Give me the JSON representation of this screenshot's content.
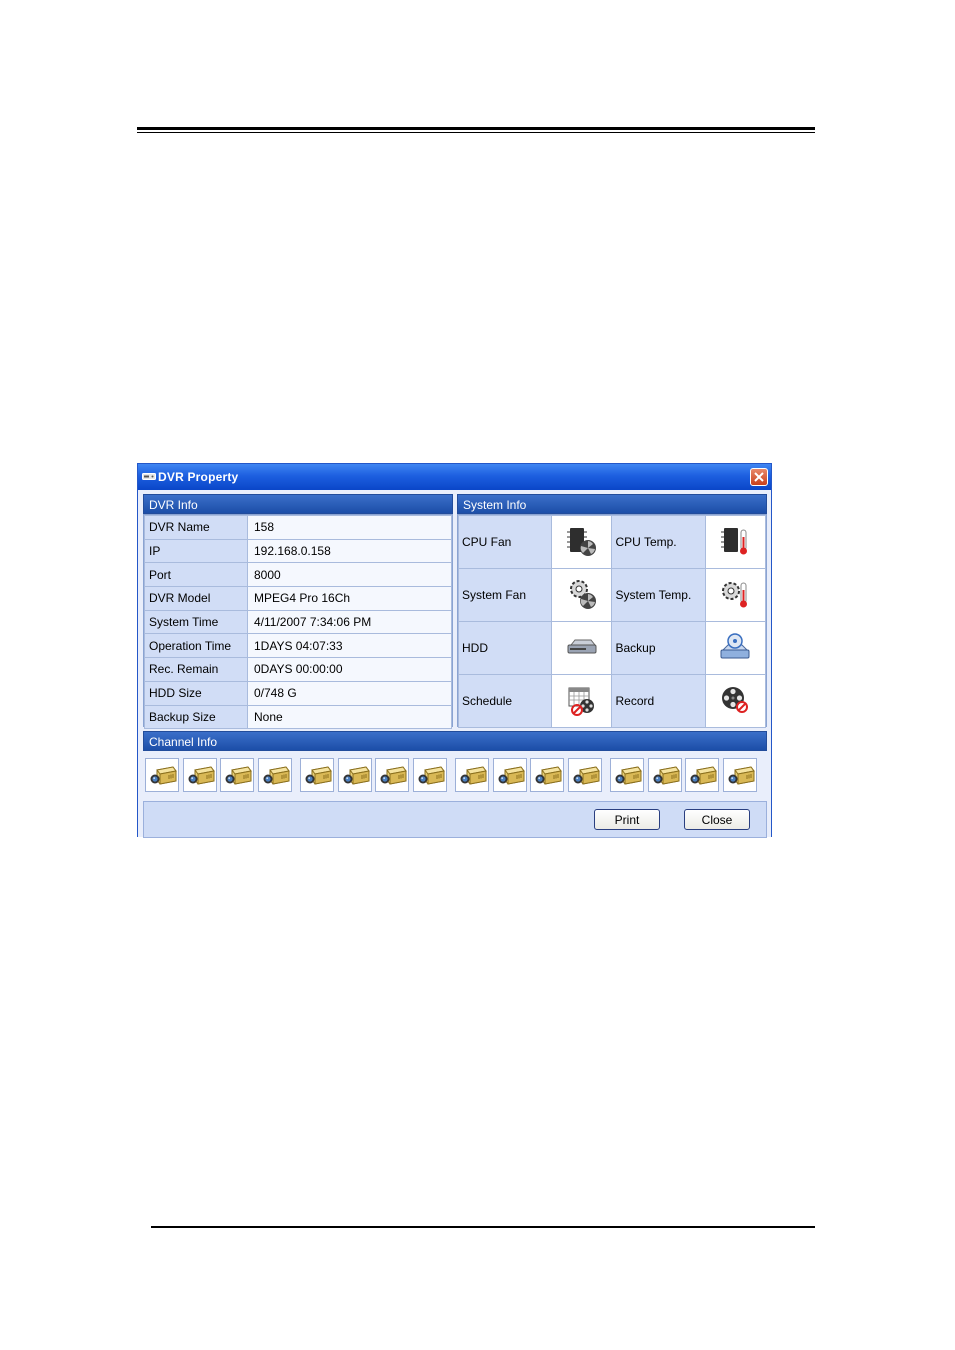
{
  "window": {
    "title": "DVR Property"
  },
  "dvr_info": {
    "header": "DVR Info",
    "rows": [
      {
        "label": "DVR Name",
        "value": "158"
      },
      {
        "label": "IP",
        "value": "192.168.0.158"
      },
      {
        "label": "Port",
        "value": "8000"
      },
      {
        "label": "DVR Model",
        "value": "MPEG4 Pro 16Ch"
      },
      {
        "label": "System Time",
        "value": "4/11/2007 7:34:06 PM"
      },
      {
        "label": "Operation Time",
        "value": "1DAYS 04:07:33"
      },
      {
        "label": "Rec. Remain",
        "value": "0DAYS 00:00:00"
      },
      {
        "label": "HDD Size",
        "value": "0/748 G"
      },
      {
        "label": "Backup Size",
        "value": "None"
      }
    ]
  },
  "system_info": {
    "header": "System Info",
    "items": [
      {
        "label": "CPU Fan",
        "icon": "cpu-fan-icon"
      },
      {
        "label": "CPU Temp.",
        "icon": "cpu-temp-icon"
      },
      {
        "label": "System Fan",
        "icon": "system-fan-icon"
      },
      {
        "label": "System Temp.",
        "icon": "system-temp-icon"
      },
      {
        "label": "HDD",
        "icon": "hdd-icon"
      },
      {
        "label": "Backup",
        "icon": "backup-icon"
      },
      {
        "label": "Schedule",
        "icon": "schedule-icon"
      },
      {
        "label": "Record",
        "icon": "record-icon"
      }
    ]
  },
  "channel_info": {
    "header": "Channel Info",
    "channel_count": 16,
    "icon": "camera-icon"
  },
  "buttons": {
    "print": "Print",
    "close": "Close"
  },
  "colors": {
    "title_bar": "#1d5fe0",
    "panel_header": "#1c4ea8",
    "close_red": "#c8401c",
    "panel_bg": "#dfe8fa"
  }
}
